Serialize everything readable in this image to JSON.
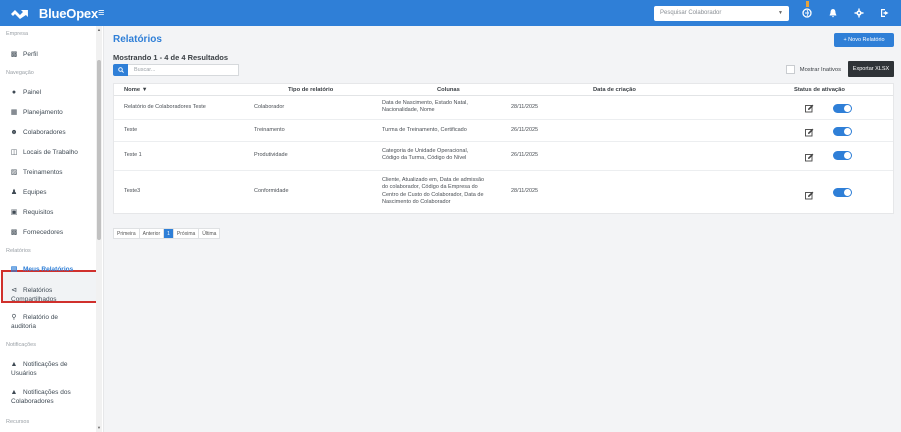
{
  "app": {
    "name": "BlueOpex"
  },
  "topbar": {
    "select_placeholder": "Pesquisar Colaborador",
    "icons": [
      "globe-icon",
      "bell-icon",
      "gear-icon",
      "logout-icon"
    ]
  },
  "sidebar": {
    "sections": {
      "empresa": "Empresa",
      "navegacao": "Navegação",
      "relatorios": "Relatórios",
      "notificacoes": "Notificações",
      "recursos": "Recursos"
    },
    "items": {
      "perfil": "Perfil",
      "painel": "Painel",
      "planejamento": "Planejamento",
      "colaboradores": "Colaboradores",
      "locais": "Locais de Trabalho",
      "treinamentos": "Treinamentos",
      "equipes": "Equipes",
      "requisitos": "Requisitos",
      "fornecedores": "Fornecedores",
      "meus_relatorios": "Meus Relatórios",
      "rel_comp_1": "Relatórios",
      "rel_comp_2": "Compartilhados",
      "rel_aud_1": "Relatório de",
      "rel_aud_2": "auditoria",
      "notif_users_1": "Notificações de",
      "notif_users_2": "Usuários",
      "notif_colab_1": "Notificações dos",
      "notif_colab_2": "Colaboradores"
    }
  },
  "main": {
    "title": "Relatórios",
    "new_button": "+ Novo Relatório",
    "showing": "Mostrando 1 - 4 de 4 Resultados",
    "search_placeholder": "Buscar...",
    "show_inactive": "Mostrar Inativos",
    "export_button": "Exportar XLSX",
    "columns": {
      "nome": "Nome ▼",
      "tipo": "Tipo de relatório",
      "colunas": "Colunas",
      "data": "Data de criação",
      "status": "Status de ativação"
    },
    "rows": [
      {
        "nome": "Relatório de Colaboradores Teste",
        "tipo": "Colaborador",
        "colunas": [
          "Data de Nascimento, Estado Natal,",
          "Nacionalidade, Nome"
        ],
        "data": "28/11/2025",
        "active": true
      },
      {
        "nome": "Teste",
        "tipo": "Treinamento",
        "colunas": [
          "Turma de Treinamento, Certificado"
        ],
        "data": "26/11/2025",
        "active": true
      },
      {
        "nome": "Teste 1",
        "tipo": "Produtividade",
        "colunas": [
          "Categoria de Unidade Operacional,",
          "Código da Turma, Código do Nível"
        ],
        "data": "26/11/2025",
        "active": true
      },
      {
        "nome": "Teste3",
        "tipo": "Conformidade",
        "colunas": [
          "Cliente, Atualizado em, Data de admissão",
          "do colaborador, Código da Empresa do",
          "Centro de Custo do Colaborador, Data de",
          "Nascimento do Colaborador"
        ],
        "data": "28/11/2025",
        "active": true
      }
    ],
    "pagination": {
      "first": "Primeira",
      "prev": "Anterior",
      "current": "1",
      "next": "Próxima",
      "last": "Última"
    }
  },
  "colors": {
    "brand": "#2f7fd7",
    "highlight": "#d0302c",
    "dark_button": "#2f3337"
  }
}
